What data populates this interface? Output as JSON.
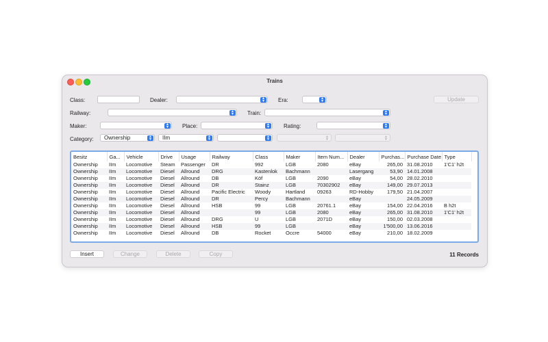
{
  "window": {
    "title": "Trains"
  },
  "filters": {
    "class_label": "Class:",
    "dealer_label": "Dealer:",
    "era_label": "Era:",
    "railway_label": "Railway:",
    "train_label": "Train:",
    "maker_label": "Maker:",
    "place_label": "Place:",
    "rating_label": "Rating:",
    "category_label": "Category:",
    "category_value": "Ownership",
    "gauge_value": "IIm",
    "update_label": "Update"
  },
  "table": {
    "columns": [
      "Besitz",
      "Ga...",
      "Vehicle",
      "Drive",
      "Usage",
      "Railway",
      "Class",
      "Maker",
      "Item Num...",
      "Dealer",
      "Purchas...",
      "Purchase Date",
      "Type"
    ],
    "rows": [
      [
        "Ownership",
        "IIm",
        "Locomotive",
        "Steam",
        "Passenger",
        "DR",
        "992",
        "LGB",
        "2080",
        "eBay",
        "265,00",
        "31.08.2010",
        "1'C1' h2t"
      ],
      [
        "Ownership",
        "IIm",
        "Locomotive",
        "Diesel",
        "Allround",
        "DRG",
        "Kastenlok",
        "Bachmann",
        "",
        "Lasergang",
        "53,90",
        "14.01.2008",
        ""
      ],
      [
        "Ownership",
        "IIm",
        "Locomotive",
        "Diesel",
        "Allround",
        "DB",
        "Köf",
        "LGB",
        "2090",
        "eBay",
        "54,00",
        "28.02.2010",
        ""
      ],
      [
        "Ownership",
        "IIm",
        "Locomotive",
        "Diesel",
        "Allround",
        "DR",
        "Stainz",
        "LGB",
        "70302902",
        "eBay",
        "149,00",
        "29.07.2013",
        ""
      ],
      [
        "Ownership",
        "IIm",
        "Locomotive",
        "Diesel",
        "Allround",
        "Pacific Electric",
        "Woody",
        "Hartland",
        "09263",
        "RD-Hobby",
        "179,50",
        "21.04.2007",
        ""
      ],
      [
        "Ownership",
        "IIm",
        "Locomotive",
        "Diesel",
        "Allround",
        "DR",
        "Percy",
        "Bachmann",
        "",
        "eBay",
        "",
        "24.05.2009",
        ""
      ],
      [
        "Ownership",
        "IIm",
        "Locomotive",
        "Diesel",
        "Allround",
        "HSB",
        "99",
        "LGB",
        "20761.1",
        "eBay",
        "154,00",
        "22.04.2016",
        "B h2t"
      ],
      [
        "Ownership",
        "IIm",
        "Locomotive",
        "Diesel",
        "Allround",
        "",
        "99",
        "LGB",
        "2080",
        "eBay",
        "265,00",
        "31.08.2010",
        "1'C1' h2t"
      ],
      [
        "Ownership",
        "IIm",
        "Locomotive",
        "Diesel",
        "Allround",
        "DRG",
        "U",
        "LGB",
        "2071D",
        "eBay",
        "150,00",
        "02.03.2008",
        ""
      ],
      [
        "Ownership",
        "IIm",
        "Locomotive",
        "Diesel",
        "Allround",
        "HSB",
        "99",
        "LGB",
        "",
        "eBay",
        "1'500,00",
        "13.06.2016",
        ""
      ],
      [
        "Ownership",
        "IIm",
        "Locomotive",
        "Diesel",
        "Allround",
        "DB",
        "Rocket",
        "Occre",
        "54000",
        "eBay",
        "210,00",
        "18.02.2009",
        ""
      ]
    ]
  },
  "footer": {
    "insert_label": "Insert",
    "change_label": "Change",
    "delete_label": "Delete",
    "copy_label": "Copy",
    "records_text": "11 Records"
  },
  "colors": {
    "accent": "#2f7cf6",
    "table_focus_border": "#7aa9e8"
  }
}
